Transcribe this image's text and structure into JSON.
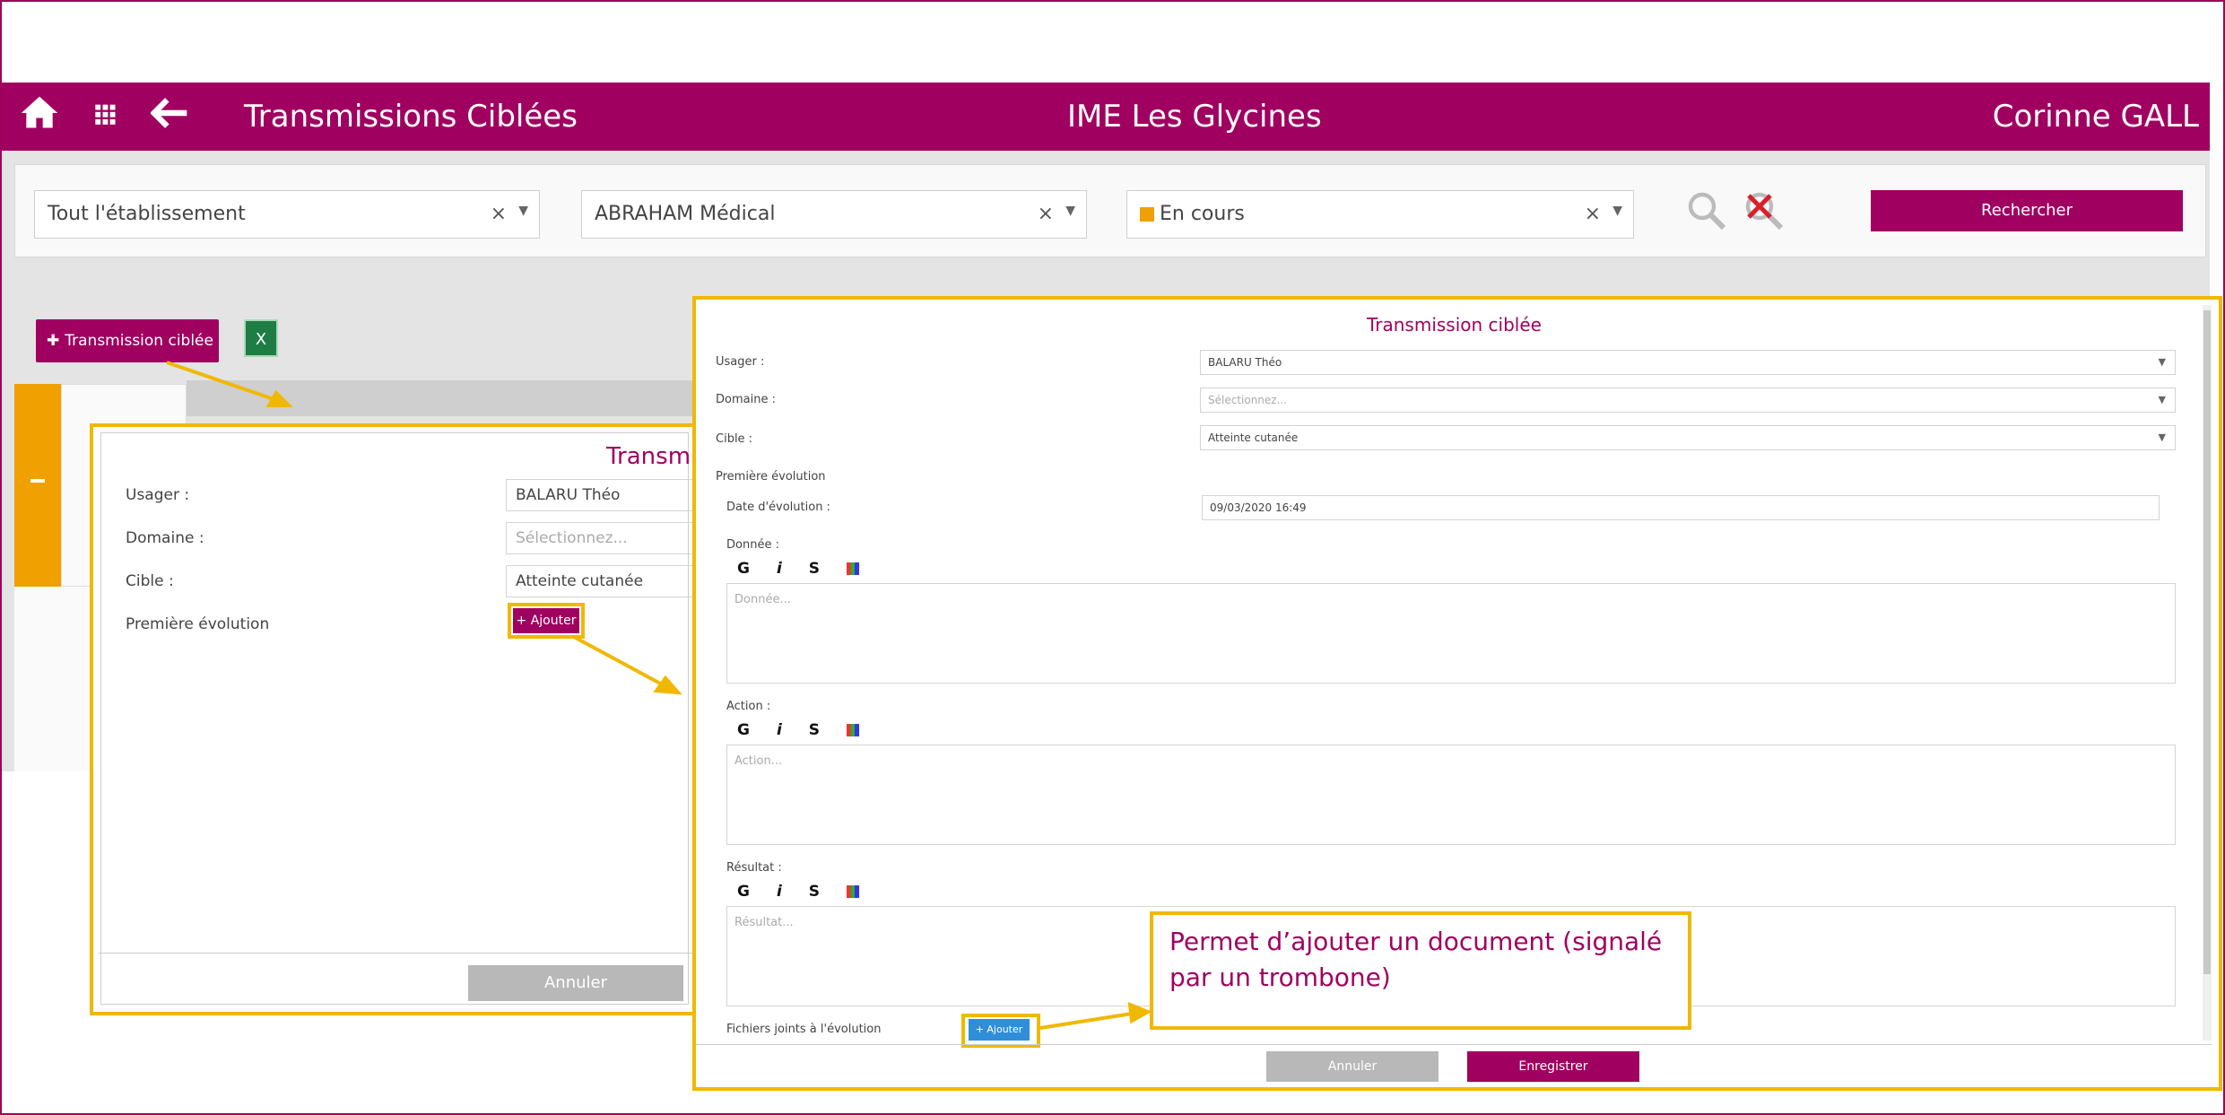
{
  "header": {
    "title": "Transmissions Ciblées",
    "establishment": "IME Les Glycines",
    "user": "Corinne GALL"
  },
  "filters": {
    "scope": "Tout l'établissement",
    "person": "ABRAHAM Médical",
    "status": "En cours",
    "clear_symbol": "×",
    "search_button": "Rechercher"
  },
  "toolbar": {
    "add_button": "Transmission ciblée",
    "excel_label": "X"
  },
  "popup_small": {
    "title": "Transmis",
    "usager_label": "Usager :",
    "usager_value": "BALARU Théo",
    "domaine_label": "Domaine :",
    "domaine_placeholder": "Sélectionnez...",
    "cible_label": "Cible :",
    "cible_value": "Atteinte cutanée",
    "evolution_label": "Première évolution",
    "add_button": "+ Ajouter",
    "cancel_button": "Annuler"
  },
  "popup_full": {
    "title": "Transmission ciblée",
    "usager_label": "Usager :",
    "usager_value": "BALARU Théo",
    "domaine_label": "Domaine :",
    "domaine_placeholder": "Sélectionnez...",
    "cible_label": "Cible :",
    "cible_value": "Atteinte cutanée",
    "evolution_heading": "Première évolution",
    "date_label": "Date d'évolution :",
    "date_value": "09/03/2020 16:49",
    "donnee_label": "Donnée :",
    "donnee_placeholder": "Donnée...",
    "action_label": "Action :",
    "action_placeholder": "Action...",
    "resultat_label": "Résultat :",
    "resultat_placeholder": "Résultat...",
    "rich_text_tools": [
      "G",
      "i",
      "S"
    ],
    "files_label": "Fichiers joints à l'évolution",
    "files_add_button": "+ Ajouter",
    "cancel_button": "Annuler",
    "save_button": "Enregistrer"
  },
  "callout": {
    "text": "Permet d’ajouter un document (signalé par un trombone)"
  },
  "colors": {
    "brand": "#a00060",
    "highlight": "#f0b800",
    "status_orange": "#f0a000",
    "file_button": "#2f8ed8"
  }
}
